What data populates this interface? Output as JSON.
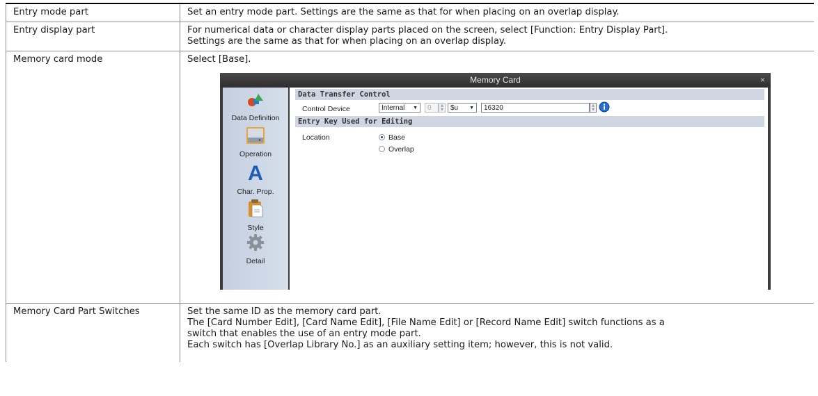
{
  "rows": [
    {
      "name": "Entry mode part",
      "desc": [
        "Set an entry mode part. Settings are the same as that for when placing on an overlap display."
      ]
    },
    {
      "name": "Entry display part",
      "desc": [
        "For numerical data or character display parts placed on the screen, select [Function: Entry Display Part].",
        "Settings are the same as that for when placing on an overlap display."
      ]
    },
    {
      "name": "Memory card mode",
      "desc": [
        "Select [Base]."
      ]
    },
    {
      "name": "Memory Card Part Switches",
      "desc": [
        "Set the same ID as the memory card part.",
        "The [Card Number Edit], [Card Name Edit], [File Name Edit] or [Record Name Edit] switch functions as a",
        "switch that enables the use of an entry mode part.",
        "Each switch has [Overlap Library No.] as an auxiliary setting item; however, this is not valid."
      ]
    }
  ],
  "dialog": {
    "title": "Memory Card",
    "close": "×",
    "sidebar": [
      {
        "label": "Data Definition",
        "icon": "data-definition-icon"
      },
      {
        "label": "Operation",
        "icon": "operation-icon"
      },
      {
        "label": "Char. Prop.",
        "icon": "char-prop-icon"
      },
      {
        "label": "Style",
        "icon": "style-icon"
      },
      {
        "label": "Detail",
        "icon": "detail-icon"
      }
    ],
    "section1": "Data Transfer Control",
    "control_device_label": "Control Device",
    "device_type": "Internal",
    "station": "0",
    "device": "$u",
    "address": "16320",
    "section2": "Entry Key Used for Editing",
    "location_label": "Location",
    "location_options": [
      "Base",
      "Overlap"
    ],
    "location_selected": "Base",
    "accent": "#cfd6e2"
  }
}
